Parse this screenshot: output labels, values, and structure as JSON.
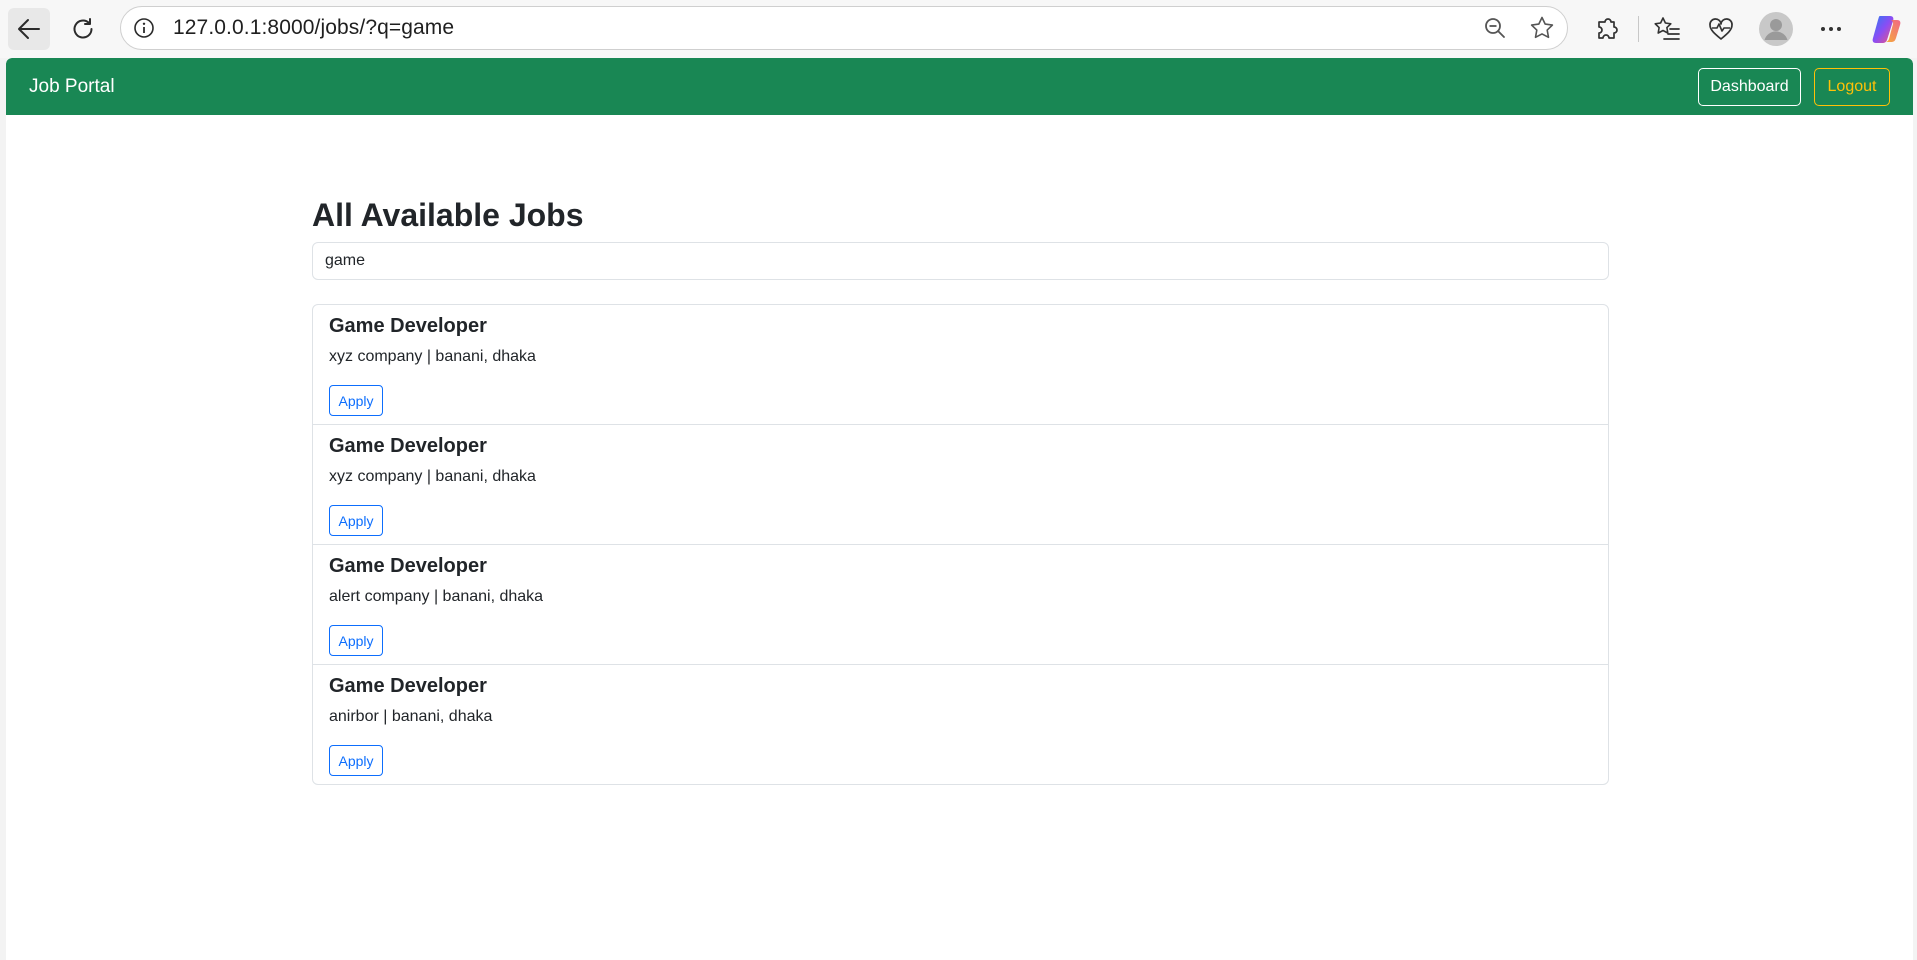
{
  "browser": {
    "url": "127.0.0.1:8000/jobs/?q=game",
    "icons": [
      "back-arrow-icon",
      "reload-icon",
      "site-info-icon",
      "zoom-out-icon",
      "favorite-star-icon",
      "extensions-icon",
      "favorites-icon",
      "browser-essentials-icon",
      "profile-avatar-icon",
      "more-options-icon",
      "copilot-icon"
    ]
  },
  "navbar": {
    "brand": "Job Portal",
    "dashboard_label": "Dashboard",
    "logout_label": "Logout",
    "colors": {
      "background": "#198754",
      "dashboard_border": "#ffffff",
      "logout": "#ffc107"
    }
  },
  "main": {
    "title": "All Available Jobs",
    "search": {
      "value": "game"
    },
    "jobs": [
      {
        "title": "Game Developer",
        "meta": "xyz company | banani, dhaka",
        "apply_label": "Apply"
      },
      {
        "title": "Game Developer",
        "meta": "xyz company | banani, dhaka",
        "apply_label": "Apply"
      },
      {
        "title": "Game Developer",
        "meta": "alert company | banani, dhaka",
        "apply_label": "Apply"
      },
      {
        "title": "Game Developer",
        "meta": "anirbor | banani, dhaka",
        "apply_label": "Apply"
      }
    ],
    "colors": {
      "apply": "#0d6efd",
      "text": "#212529"
    }
  }
}
